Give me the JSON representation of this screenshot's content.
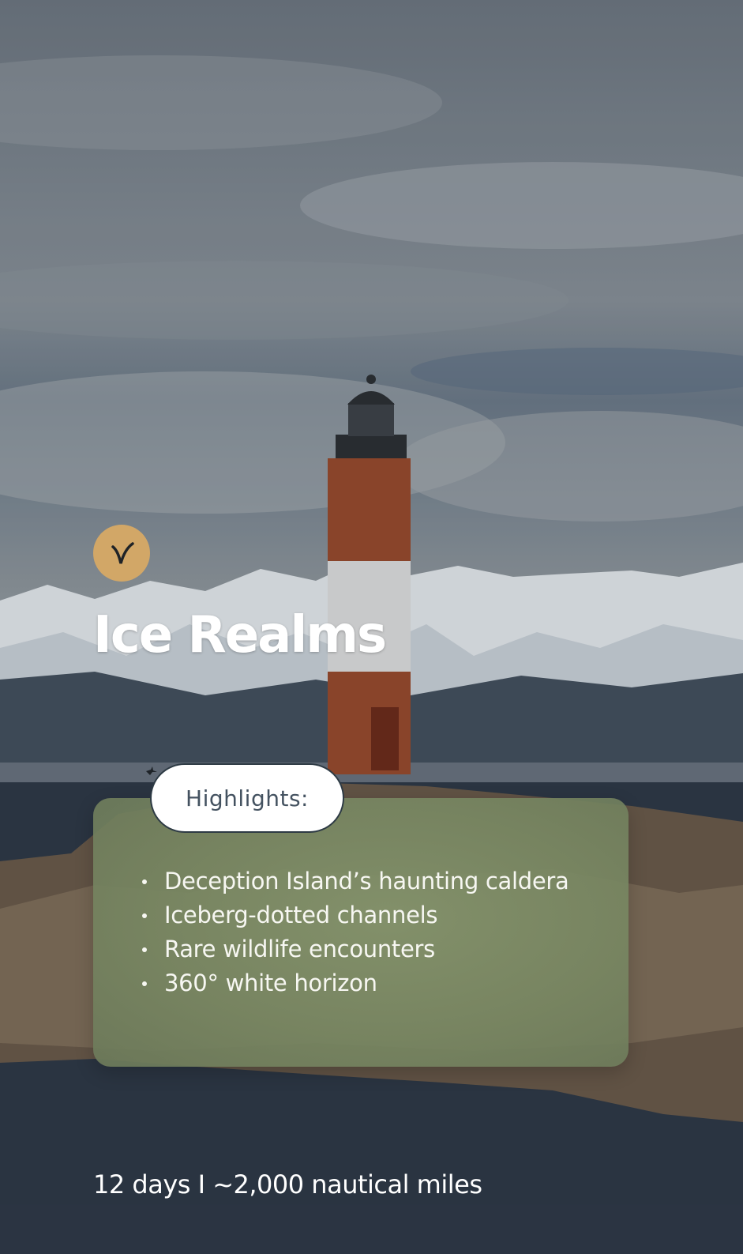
{
  "title": "Ice Realms",
  "highlights": {
    "label": "Highlights:",
    "items": [
      "Deception Island’s haunting caldera",
      "Iceberg-dotted channels",
      "Rare wildlife encounters",
      "360° white horizon"
    ]
  },
  "trip_summary": "12 days I ~2,000 nautical miles",
  "colors": {
    "badge": "#d2a767",
    "card": "#7f8f66",
    "text": "#ffffff",
    "pill_text": "#445260"
  }
}
